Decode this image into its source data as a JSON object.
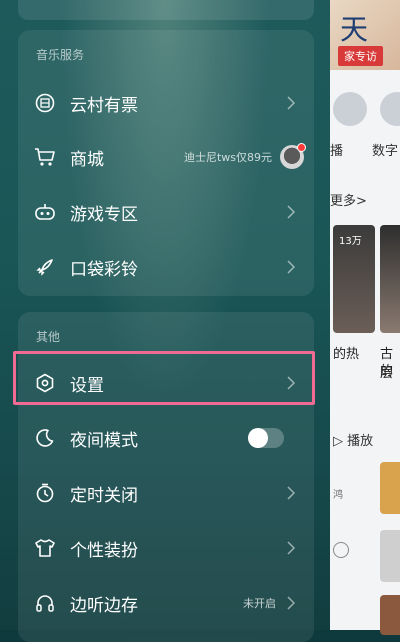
{
  "background_app": {
    "banner_char": "天",
    "banner_tag": "家专访",
    "row_labels": [
      "播",
      "数字"
    ],
    "more_label": "更多>",
    "badge": "13万",
    "caption1": "的热",
    "caption2a": "古层",
    "caption2b": "的",
    "play_label": "▷ 播放",
    "small_text": "鸿"
  },
  "drawer": {
    "sections": [
      {
        "title": "音乐服务",
        "items": [
          {
            "label": "云村有票",
            "icon": "ticket-icon"
          },
          {
            "label": "商城",
            "icon": "cart-icon",
            "meta": "迪士尼tws仅89元"
          },
          {
            "label": "游戏专区",
            "icon": "gamepad-icon"
          },
          {
            "label": "口袋彩铃",
            "icon": "rocket-icon"
          }
        ]
      },
      {
        "title": "其他",
        "items": [
          {
            "label": "设置",
            "icon": "settings-hexagon-icon"
          },
          {
            "label": "夜间模式",
            "icon": "moon-icon",
            "toggle": false
          },
          {
            "label": "定时关闭",
            "icon": "timer-icon"
          },
          {
            "label": "个性装扮",
            "icon": "tshirt-icon"
          },
          {
            "label": "边听边存",
            "icon": "headphones-icon",
            "meta": "未开启"
          }
        ]
      }
    ]
  },
  "colors": {
    "highlight": "#f06a93",
    "drawer_bg": "#1a5656"
  }
}
